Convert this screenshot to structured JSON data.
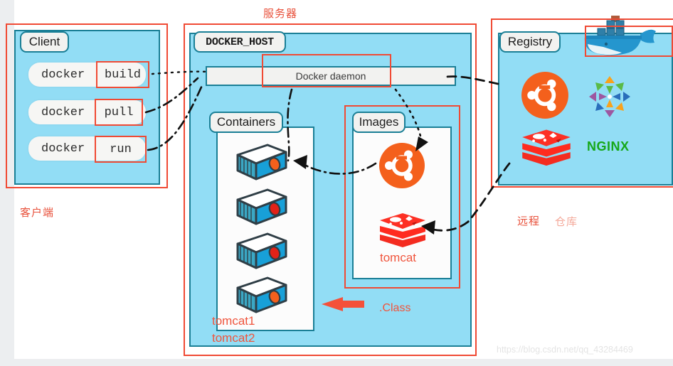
{
  "annotations": {
    "server": "服务器",
    "client_cn": "客户端",
    "remote": "远程",
    "repository": "仓库",
    "class_label": ".Class"
  },
  "client": {
    "title": "Client",
    "commands": [
      {
        "prefix": "docker",
        "verb": "build"
      },
      {
        "prefix": "docker",
        "verb": "pull"
      },
      {
        "prefix": "docker",
        "verb": "run"
      }
    ]
  },
  "docker_host": {
    "title": "DOCKER_HOST",
    "daemon": "Docker daemon",
    "containers": {
      "title": "Containers",
      "count": 4,
      "labels": [
        "tomcat1",
        "tomcat2"
      ]
    },
    "images": {
      "title": "Images",
      "items": [
        {
          "icon": "ubuntu-logo-icon",
          "label": ""
        },
        {
          "icon": "redis-stack-icon",
          "label": "tomcat"
        }
      ]
    }
  },
  "registry": {
    "title": "Registry",
    "whale_icon": "docker-whale-icon",
    "items": [
      {
        "icon": "ubuntu-logo-icon",
        "label": ""
      },
      {
        "icon": "centos-logo-icon",
        "label": ""
      },
      {
        "icon": "redis-stack-icon",
        "label": ""
      },
      {
        "icon": "nginx-logo-icon",
        "label": "NGINX"
      }
    ]
  },
  "watermark": "https://blog.csdn.net/qq_43284469",
  "colors": {
    "panel_fill": "#92ddf5",
    "panel_border": "#1a7f96",
    "annotation_red": "#f04a34",
    "label_red": "#e8503a",
    "ubuntu_orange": "#f4601c",
    "redis_red": "#f42c20",
    "nginx_green": "#17a81a",
    "whale_blue": "#1d91c0"
  }
}
